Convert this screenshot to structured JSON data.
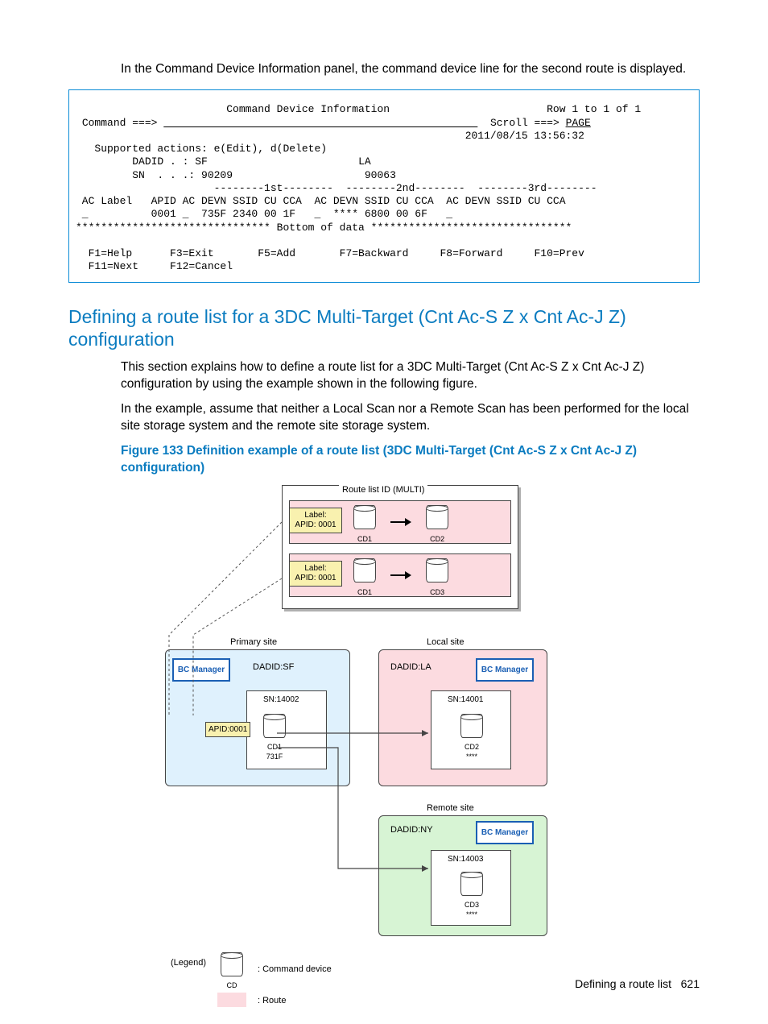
{
  "intro": "In the Command Device Information panel, the command device line for the second route is displayed.",
  "terminal": {
    "title": "Command Device Information",
    "rowinfo": "Row 1 to 1 of 1",
    "cmd_label": "Command ===>",
    "scroll_label": "Scroll ===>",
    "scroll_value": "PAGE",
    "timestamp": "2011/08/15 13:56:32",
    "supported": "Supported actions: e(Edit), d(Delete)",
    "dadid_label": "DADID . : SF",
    "dadid_la": "LA",
    "sn_label": "SN  . . .: 90209",
    "sn_la": "90063",
    "dash_row": "--------1st--------  --------2nd--------  --------3rd--------",
    "col_head": " AC Label   APID AC DEVN SSID CU CCA  AC DEVN SSID CU CCA  AC DEVN SSID CU CCA",
    "data_row": " _          0001 _  735F 2340 00 1F   _  **** 6800 00 6F   _",
    "bottom": "******************************* Bottom of data ********************************",
    "fkeys1": "  F1=Help      F3=Exit       F5=Add       F7=Backward     F8=Forward     F10=Prev",
    "fkeys2": "  F11=Next     F12=Cancel"
  },
  "section_title": "Defining a route list for a 3DC Multi-Target (Cnt Ac-S Z x Cnt Ac-J Z) configuration",
  "para1": "This section explains how to define a route list for a 3DC Multi-Target (Cnt Ac-S Z x Cnt Ac-J Z) configuration by using the example shown in the following figure.",
  "para2": "In the example, assume that neither a Local Scan nor a Remote Scan has been performed for the local site storage system and the remote site storage system.",
  "figcap": "Figure 133 Definition example of a route list (3DC Multi-Target (Cnt Ac-S Z x Cnt Ac-J Z) configuration)",
  "diagram": {
    "route_id": "Route list ID (MULTI)",
    "tag_label_1a": "Label:",
    "tag_label_1b": "APID: 0001",
    "tag_label_2a": "Label:",
    "tag_label_2b": "APID: 0001",
    "cd1": "CD1",
    "cd2": "CD2",
    "cd3": "CD3",
    "primary": "Primary site",
    "local": "Local site",
    "remote": "Remote site",
    "dadid_sf": "DADID:SF",
    "dadid_la": "DADID:LA",
    "dadid_ny": "DADID:NY",
    "bcman": "BC Manager",
    "sn_p": "SN:14002",
    "sn_l": "SN:14001",
    "sn_r": "SN:14003",
    "apid": "APID:0001",
    "dev_p": "731F",
    "dev_l": "****",
    "dev_r": "****",
    "legend_title": "(Legend)",
    "legend_cd": ": Command device",
    "legend_route": ": Route",
    "legend_cd_icon": "CD"
  },
  "footer_label": "Defining a route list",
  "footer_page": "621"
}
